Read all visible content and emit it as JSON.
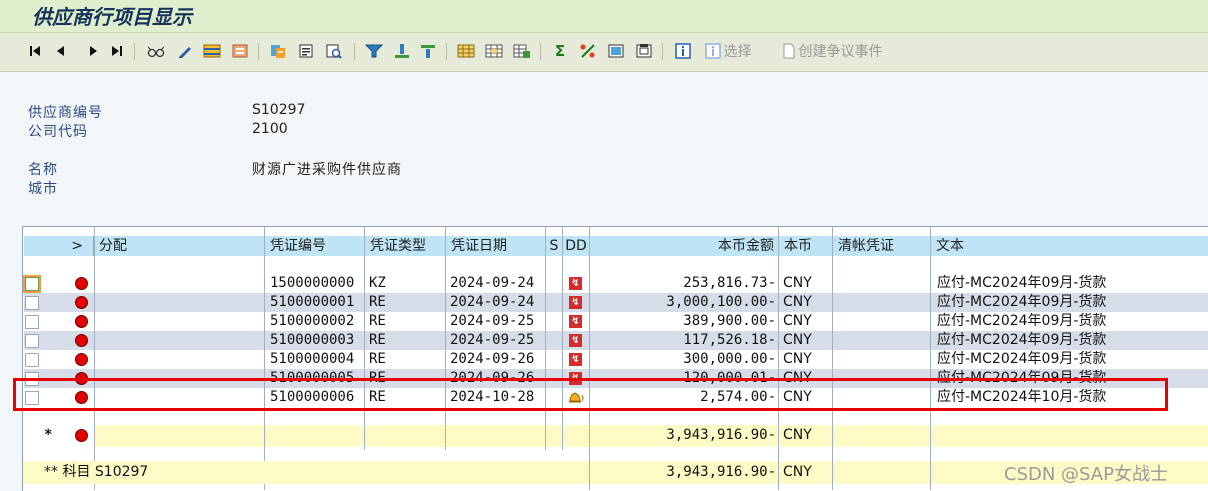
{
  "window": {
    "title": "供应商行项目显示"
  },
  "toolbar": {
    "icons": [
      "first-page-icon",
      "prev-page-icon",
      "next-page-icon",
      "last-page-icon",
      "glasses-icon",
      "pencil-icon",
      "column-settings-icon",
      "layout-icon",
      "doc-icon",
      "detail-icon",
      "find-icon",
      "filter-icon",
      "sum-icon",
      "subtotal-icon",
      "grid-icon",
      "grid-select-icon",
      "grid-export-icon",
      "sigma-icon",
      "percent-icon",
      "view-icon",
      "view2-icon",
      "info-icon"
    ],
    "select_label": "选择",
    "dispute_label": "创建争议事件"
  },
  "header": {
    "vendor_label": "供应商编号",
    "vendor_value": "S10297",
    "company_label": "公司代码",
    "company_value": "2100",
    "name_label": "名称",
    "name_value": "财源广进采购件供应商",
    "city_label": "城市"
  },
  "table": {
    "columns": {
      "arrow": ">",
      "assign": "分配",
      "doc_no": "凭证编号",
      "doc_type": "凭证类型",
      "doc_date": "凭证日期",
      "s": "S",
      "dd": "DD",
      "amount": "本币金额",
      "currency": "本币",
      "clearing": "清帐凭证",
      "text": "文本"
    },
    "rows": [
      {
        "doc_no": "1500000000",
        "type": "KZ",
        "date": "2024-09-24",
        "dd": "lightning",
        "amount": "253,816.73-",
        "cur": "CNY",
        "text": "应付-MC2024年09月-货款"
      },
      {
        "doc_no": "5100000001",
        "type": "RE",
        "date": "2024-09-24",
        "dd": "lightning",
        "amount": "3,000,100.00-",
        "cur": "CNY",
        "text": "应付-MC2024年09月-货款"
      },
      {
        "doc_no": "5100000002",
        "type": "RE",
        "date": "2024-09-25",
        "dd": "lightning",
        "amount": "389,900.00-",
        "cur": "CNY",
        "text": "应付-MC2024年09月-货款"
      },
      {
        "doc_no": "5100000003",
        "type": "RE",
        "date": "2024-09-25",
        "dd": "lightning",
        "amount": "117,526.18-",
        "cur": "CNY",
        "text": "应付-MC2024年09月-货款"
      },
      {
        "doc_no": "5100000004",
        "type": "RE",
        "date": "2024-09-26",
        "dd": "lightning",
        "amount": "300,000.00-",
        "cur": "CNY",
        "text": "应付-MC2024年09月-货款"
      },
      {
        "doc_no": "5100000005",
        "type": "RE",
        "date": "2024-09-26",
        "dd": "lightning",
        "amount": "120,000.01-",
        "cur": "CNY",
        "text": "应付-MC2024年09月-货款"
      },
      {
        "doc_no": "5100000006",
        "type": "RE",
        "date": "2024-10-28",
        "dd": "bell",
        "amount": "2,574.00-",
        "cur": "CNY",
        "text": "应付-MC2024年10月-货款"
      }
    ],
    "subtotal": {
      "mark": "*",
      "amount": "3,943,916.90-",
      "cur": "CNY"
    },
    "total": {
      "label": "** 科目 S10297",
      "amount": "3,943,916.90-",
      "cur": "CNY"
    }
  },
  "watermark": "CSDN @SAP女战士",
  "colors": {
    "header_blue": "#bfe4f5",
    "row_alt": "#d6dde9",
    "subtotal_yellow": "#fdfbc5",
    "highlight_red": "#e60000",
    "status_red": "#e00000"
  }
}
